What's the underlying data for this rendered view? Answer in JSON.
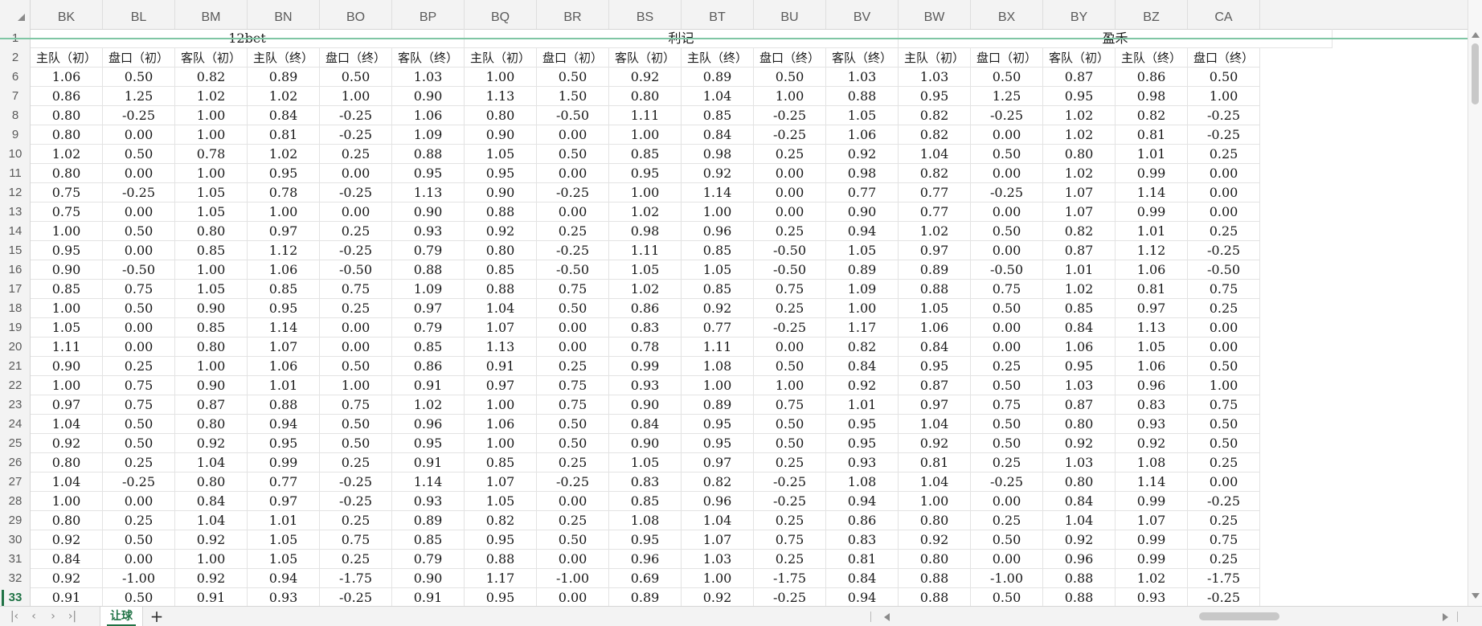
{
  "columns": [
    "BK",
    "BL",
    "BM",
    "BN",
    "BO",
    "BP",
    "BQ",
    "BR",
    "BS",
    "BT",
    "BU",
    "BV",
    "BW",
    "BX",
    "BY",
    "BZ",
    "CA"
  ],
  "groups": [
    "12bet",
    "利记",
    "盈禾"
  ],
  "subheaders": [
    "主队（初）",
    "盘口（初）",
    "客队（初）",
    "主队（终）",
    "盘口（终）",
    "客队（终）",
    "主队（初）",
    "盘口（初）",
    "客队（初）",
    "主队（终）",
    "盘口（终）",
    "客队（终）",
    "主队（初）",
    "盘口（初）",
    "客队（初）",
    "主队（终）",
    "盘口（终）"
  ],
  "header_row_numbers": [
    "1",
    "2"
  ],
  "active_row": "33",
  "rows": [
    {
      "n": "6",
      "v": [
        "1.06",
        "0.50",
        "0.82",
        "0.89",
        "0.50",
        "1.03",
        "1.00",
        "0.50",
        "0.92",
        "0.89",
        "0.50",
        "1.03",
        "1.03",
        "0.50",
        "0.87",
        "0.86",
        "0.50"
      ]
    },
    {
      "n": "7",
      "v": [
        "0.86",
        "1.25",
        "1.02",
        "1.02",
        "1.00",
        "0.90",
        "1.13",
        "1.50",
        "0.80",
        "1.04",
        "1.00",
        "0.88",
        "0.95",
        "1.25",
        "0.95",
        "0.98",
        "1.00"
      ]
    },
    {
      "n": "8",
      "v": [
        "0.80",
        "-0.25",
        "1.00",
        "0.84",
        "-0.25",
        "1.06",
        "0.80",
        "-0.50",
        "1.11",
        "0.85",
        "-0.25",
        "1.05",
        "0.82",
        "-0.25",
        "1.02",
        "0.82",
        "-0.25"
      ]
    },
    {
      "n": "9",
      "v": [
        "0.80",
        "0.00",
        "1.00",
        "0.81",
        "-0.25",
        "1.09",
        "0.90",
        "0.00",
        "1.00",
        "0.84",
        "-0.25",
        "1.06",
        "0.82",
        "0.00",
        "1.02",
        "0.81",
        "-0.25"
      ]
    },
    {
      "n": "10",
      "v": [
        "1.02",
        "0.50",
        "0.78",
        "1.02",
        "0.25",
        "0.88",
        "1.05",
        "0.50",
        "0.85",
        "0.98",
        "0.25",
        "0.92",
        "1.04",
        "0.50",
        "0.80",
        "1.01",
        "0.25"
      ]
    },
    {
      "n": "11",
      "v": [
        "0.80",
        "0.00",
        "1.00",
        "0.95",
        "0.00",
        "0.95",
        "0.95",
        "0.00",
        "0.95",
        "0.92",
        "0.00",
        "0.98",
        "0.82",
        "0.00",
        "1.02",
        "0.99",
        "0.00"
      ]
    },
    {
      "n": "12",
      "v": [
        "0.75",
        "-0.25",
        "1.05",
        "0.78",
        "-0.25",
        "1.13",
        "0.90",
        "-0.25",
        "1.00",
        "1.14",
        "0.00",
        "0.77",
        "0.77",
        "-0.25",
        "1.07",
        "1.14",
        "0.00"
      ]
    },
    {
      "n": "13",
      "v": [
        "0.75",
        "0.00",
        "1.05",
        "1.00",
        "0.00",
        "0.90",
        "0.88",
        "0.00",
        "1.02",
        "1.00",
        "0.00",
        "0.90",
        "0.77",
        "0.00",
        "1.07",
        "0.99",
        "0.00"
      ]
    },
    {
      "n": "14",
      "v": [
        "1.00",
        "0.50",
        "0.80",
        "0.97",
        "0.25",
        "0.93",
        "0.92",
        "0.25",
        "0.98",
        "0.96",
        "0.25",
        "0.94",
        "1.02",
        "0.50",
        "0.82",
        "1.01",
        "0.25"
      ]
    },
    {
      "n": "15",
      "v": [
        "0.95",
        "0.00",
        "0.85",
        "1.12",
        "-0.25",
        "0.79",
        "0.80",
        "-0.25",
        "1.11",
        "0.85",
        "-0.50",
        "1.05",
        "0.97",
        "0.00",
        "0.87",
        "1.12",
        "-0.25"
      ]
    },
    {
      "n": "16",
      "v": [
        "0.90",
        "-0.50",
        "1.00",
        "1.06",
        "-0.50",
        "0.88",
        "0.85",
        "-0.50",
        "1.05",
        "1.05",
        "-0.50",
        "0.89",
        "0.89",
        "-0.50",
        "1.01",
        "1.06",
        "-0.50"
      ]
    },
    {
      "n": "17",
      "v": [
        "0.85",
        "0.75",
        "1.05",
        "0.85",
        "0.75",
        "1.09",
        "0.88",
        "0.75",
        "1.02",
        "0.85",
        "0.75",
        "1.09",
        "0.88",
        "0.75",
        "1.02",
        "0.81",
        "0.75"
      ]
    },
    {
      "n": "18",
      "v": [
        "1.00",
        "0.50",
        "0.90",
        "0.95",
        "0.25",
        "0.97",
        "1.04",
        "0.50",
        "0.86",
        "0.92",
        "0.25",
        "1.00",
        "1.05",
        "0.50",
        "0.85",
        "0.97",
        "0.25"
      ]
    },
    {
      "n": "19",
      "v": [
        "1.05",
        "0.00",
        "0.85",
        "1.14",
        "0.00",
        "0.79",
        "1.07",
        "0.00",
        "0.83",
        "0.77",
        "-0.25",
        "1.17",
        "1.06",
        "0.00",
        "0.84",
        "1.13",
        "0.00"
      ]
    },
    {
      "n": "20",
      "v": [
        "1.11",
        "0.00",
        "0.80",
        "1.07",
        "0.00",
        "0.85",
        "1.13",
        "0.00",
        "0.78",
        "1.11",
        "0.00",
        "0.82",
        "0.84",
        "0.00",
        "1.06",
        "1.05",
        "0.00"
      ]
    },
    {
      "n": "21",
      "v": [
        "0.90",
        "0.25",
        "1.00",
        "1.06",
        "0.50",
        "0.86",
        "0.91",
        "0.25",
        "0.99",
        "1.08",
        "0.50",
        "0.84",
        "0.95",
        "0.25",
        "0.95",
        "1.06",
        "0.50"
      ]
    },
    {
      "n": "22",
      "v": [
        "1.00",
        "0.75",
        "0.90",
        "1.01",
        "1.00",
        "0.91",
        "0.97",
        "0.75",
        "0.93",
        "1.00",
        "1.00",
        "0.92",
        "0.87",
        "0.50",
        "1.03",
        "0.96",
        "1.00"
      ]
    },
    {
      "n": "23",
      "v": [
        "0.97",
        "0.75",
        "0.87",
        "0.88",
        "0.75",
        "1.02",
        "1.00",
        "0.75",
        "0.90",
        "0.89",
        "0.75",
        "1.01",
        "0.97",
        "0.75",
        "0.87",
        "0.83",
        "0.75"
      ]
    },
    {
      "n": "24",
      "v": [
        "1.04",
        "0.50",
        "0.80",
        "0.94",
        "0.50",
        "0.96",
        "1.06",
        "0.50",
        "0.84",
        "0.95",
        "0.50",
        "0.95",
        "1.04",
        "0.50",
        "0.80",
        "0.93",
        "0.50"
      ]
    },
    {
      "n": "25",
      "v": [
        "0.92",
        "0.50",
        "0.92",
        "0.95",
        "0.50",
        "0.95",
        "1.00",
        "0.50",
        "0.90",
        "0.95",
        "0.50",
        "0.95",
        "0.92",
        "0.50",
        "0.92",
        "0.92",
        "0.50"
      ]
    },
    {
      "n": "26",
      "v": [
        "0.80",
        "0.25",
        "1.04",
        "0.99",
        "0.25",
        "0.91",
        "0.85",
        "0.25",
        "1.05",
        "0.97",
        "0.25",
        "0.93",
        "0.81",
        "0.25",
        "1.03",
        "1.08",
        "0.25"
      ]
    },
    {
      "n": "27",
      "v": [
        "1.04",
        "-0.25",
        "0.80",
        "0.77",
        "-0.25",
        "1.14",
        "1.07",
        "-0.25",
        "0.83",
        "0.82",
        "-0.25",
        "1.08",
        "1.04",
        "-0.25",
        "0.80",
        "1.14",
        "0.00"
      ]
    },
    {
      "n": "28",
      "v": [
        "1.00",
        "0.00",
        "0.84",
        "0.97",
        "-0.25",
        "0.93",
        "1.05",
        "0.00",
        "0.85",
        "0.96",
        "-0.25",
        "0.94",
        "1.00",
        "0.00",
        "0.84",
        "0.99",
        "-0.25"
      ]
    },
    {
      "n": "29",
      "v": [
        "0.80",
        "0.25",
        "1.04",
        "1.01",
        "0.25",
        "0.89",
        "0.82",
        "0.25",
        "1.08",
        "1.04",
        "0.25",
        "0.86",
        "0.80",
        "0.25",
        "1.04",
        "1.07",
        "0.25"
      ]
    },
    {
      "n": "30",
      "v": [
        "0.92",
        "0.50",
        "0.92",
        "1.05",
        "0.75",
        "0.85",
        "0.95",
        "0.50",
        "0.95",
        "1.07",
        "0.75",
        "0.83",
        "0.92",
        "0.50",
        "0.92",
        "0.99",
        "0.75"
      ]
    },
    {
      "n": "31",
      "v": [
        "0.84",
        "0.00",
        "1.00",
        "1.05",
        "0.25",
        "0.79",
        "0.88",
        "0.00",
        "0.96",
        "1.03",
        "0.25",
        "0.81",
        "0.80",
        "0.00",
        "0.96",
        "0.99",
        "0.25"
      ]
    },
    {
      "n": "32",
      "v": [
        "0.92",
        "-1.00",
        "0.92",
        "0.94",
        "-1.75",
        "0.90",
        "1.17",
        "-1.00",
        "0.69",
        "1.00",
        "-1.75",
        "0.84",
        "0.88",
        "-1.00",
        "0.88",
        "1.02",
        "-1.75"
      ]
    },
    {
      "n": "33",
      "v": [
        "0.91",
        "0.50",
        "0.91",
        "0.93",
        "-0.25",
        "0.91",
        "0.95",
        "0.00",
        "0.89",
        "0.92",
        "-0.25",
        "0.94",
        "0.88",
        "0.50",
        "0.88",
        "0.93",
        "-0.25"
      ]
    }
  ],
  "sheet_tab": "让球",
  "add_sheet_label": "+",
  "nav_icons": {
    "first": "first-sheet-icon",
    "prev": "prev-sheet-icon",
    "next": "next-sheet-icon",
    "last": "last-sheet-icon"
  },
  "colors": {
    "accent": "#217346",
    "freeze_line": "#7fc6a4",
    "grid_line": "#e3e3e3"
  }
}
